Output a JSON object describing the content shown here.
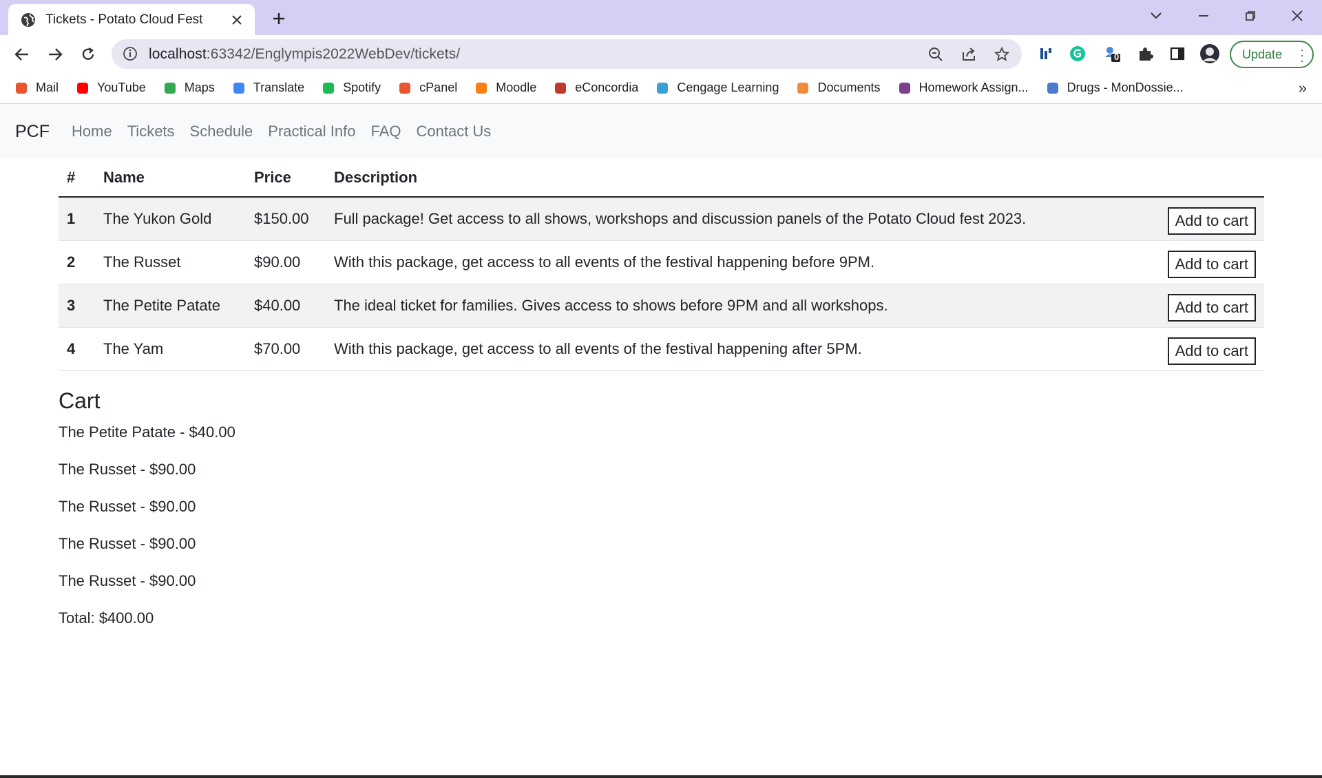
{
  "browser": {
    "tab_title": "Tickets - Potato Cloud Fest",
    "url_host": "localhost",
    "url_path": ":63342/Englympis2022WebDev/tickets/",
    "update_label": "Update",
    "extension_badge": "0",
    "bookmarks": [
      {
        "label": "Mail",
        "icon": "cpanel-icon",
        "color": "#e8552e"
      },
      {
        "label": "YouTube",
        "icon": "youtube-icon",
        "color": "#ff0000"
      },
      {
        "label": "Maps",
        "icon": "maps-icon",
        "color": "#34a853"
      },
      {
        "label": "Translate",
        "icon": "translate-icon",
        "color": "#4285f4"
      },
      {
        "label": "Spotify",
        "icon": "spotify-icon",
        "color": "#1db954"
      },
      {
        "label": "cPanel",
        "icon": "cpanel-icon",
        "color": "#e8552e"
      },
      {
        "label": "Moodle",
        "icon": "moodle-icon",
        "color": "#f98012"
      },
      {
        "label": "eConcordia",
        "icon": "econcordia-icon",
        "color": "#c0392b"
      },
      {
        "label": "Cengage Learning",
        "icon": "cengage-icon",
        "color": "#3aa0d8"
      },
      {
        "label": "Documents",
        "icon": "documents-icon",
        "color": "#f08a3c"
      },
      {
        "label": "Homework Assign...",
        "icon": "trello-icon",
        "color": "#7b3f8c"
      },
      {
        "label": "Drugs - MonDossie...",
        "icon": "globe-icon",
        "color": "#4a7bd0"
      }
    ]
  },
  "navbar": {
    "brand": "PCF",
    "links": [
      "Home",
      "Tickets",
      "Schedule",
      "Practical Info",
      "FAQ",
      "Contact Us"
    ]
  },
  "table": {
    "headers": [
      "#",
      "Name",
      "Price",
      "Description"
    ],
    "rows": [
      {
        "num": "1",
        "name": "The Yukon Gold",
        "price": "$150.00",
        "description": "Full package! Get access to all shows, workshops and discussion panels of the Potato Cloud fest 2023.",
        "button": "Add to cart"
      },
      {
        "num": "2",
        "name": "The Russet",
        "price": "$90.00",
        "description": "With this package, get access to all events of the festival happening before 9PM.",
        "button": "Add to cart"
      },
      {
        "num": "3",
        "name": "The Petite Patate",
        "price": "$40.00",
        "description": "The ideal ticket for families. Gives access to shows before 9PM and all workshops.",
        "button": "Add to cart"
      },
      {
        "num": "4",
        "name": "The Yam",
        "price": "$70.00",
        "description": "With this package, get access to all events of the festival happening after 5PM.",
        "button": "Add to cart"
      }
    ]
  },
  "cart": {
    "title": "Cart",
    "items": [
      "The Petite Patate - $40.00",
      "The Russet - $90.00",
      "The Russet - $90.00",
      "The Russet - $90.00",
      "The Russet - $90.00"
    ],
    "total": "Total: $400.00"
  }
}
